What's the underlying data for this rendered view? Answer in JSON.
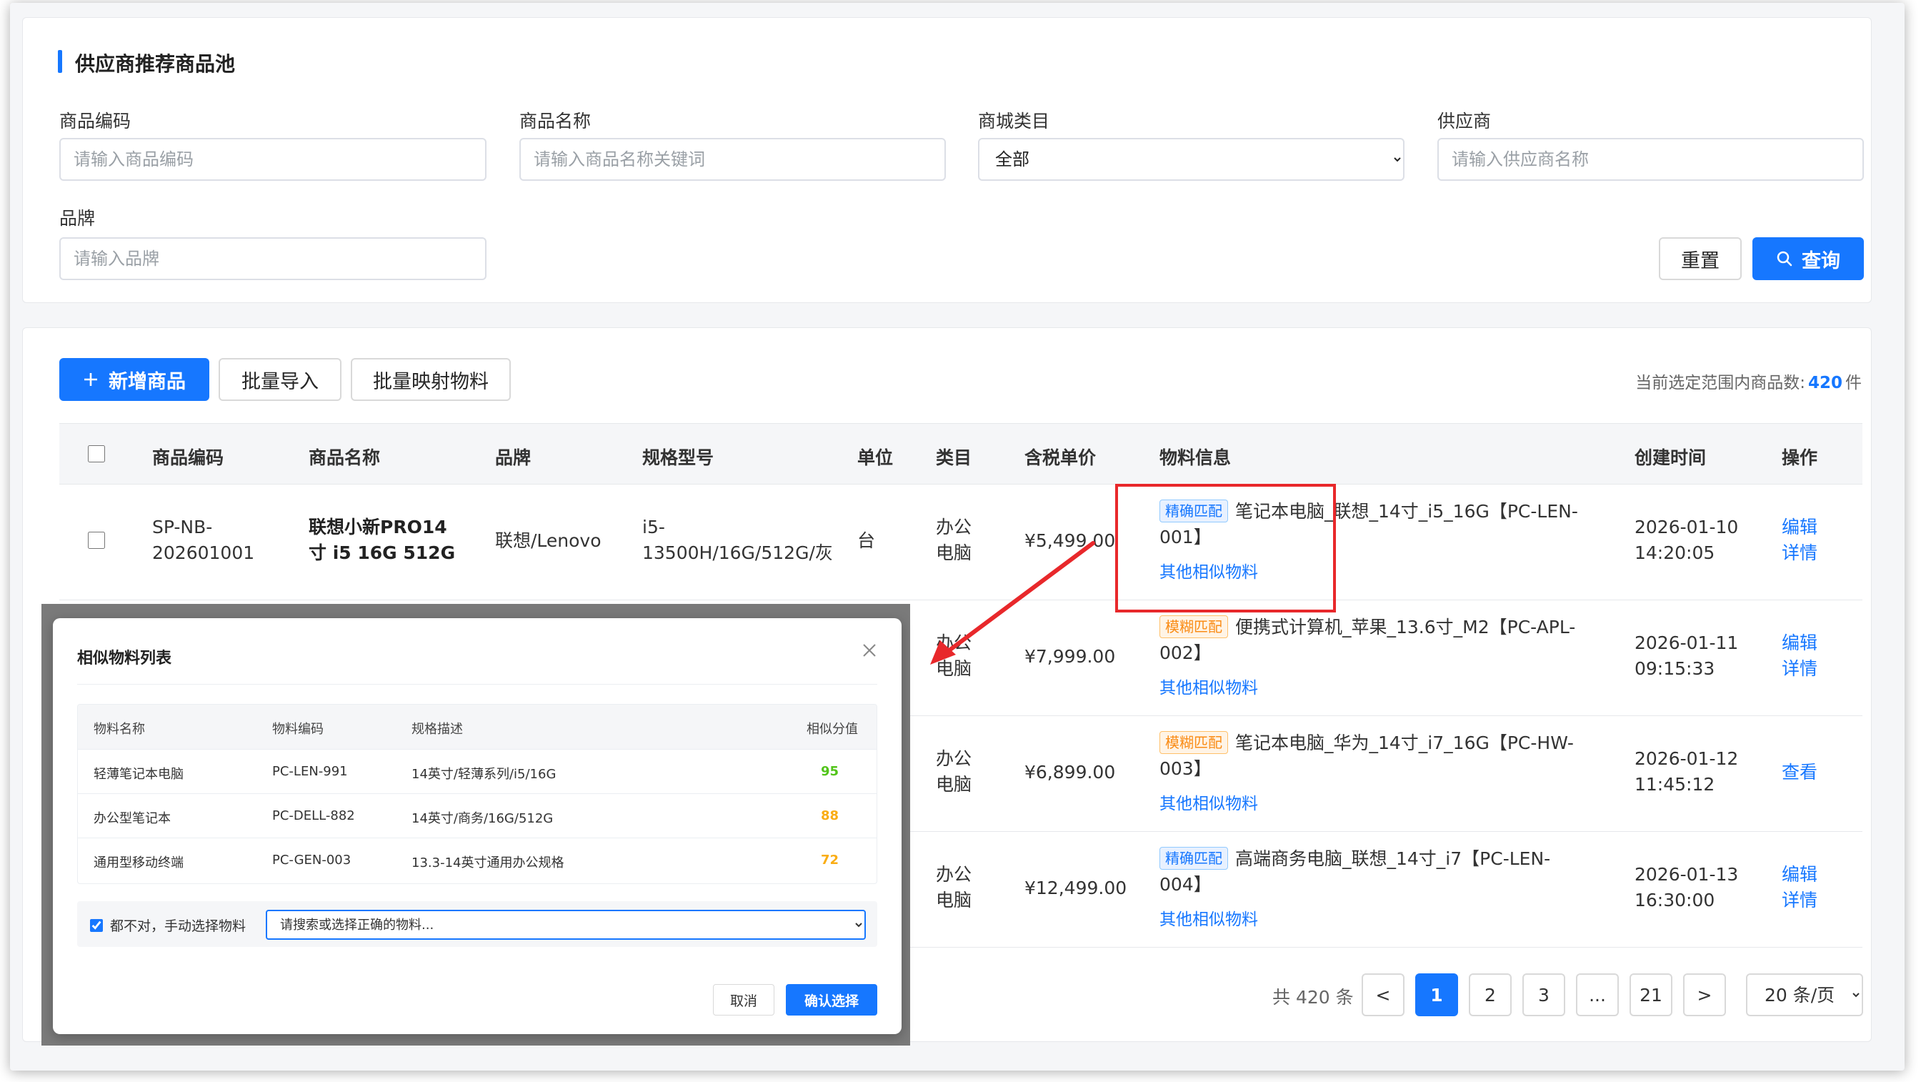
{
  "page": {
    "title": "供应商推荐商品池"
  },
  "filters": {
    "code_label": "商品编码",
    "code_placeholder": "请输入商品编码",
    "name_label": "商品名称",
    "name_placeholder": "请输入商品名称关键词",
    "category_label": "商城类目",
    "category_value": "全部",
    "supplier_label": "供应商",
    "supplier_placeholder": "请输入供应商名称",
    "brand_label": "品牌",
    "brand_placeholder": "请输入品牌",
    "reset_label": "重置",
    "search_label": "查询"
  },
  "toolbar": {
    "add_label": "新增商品",
    "import_label": "批量导入",
    "map_label": "批量映射物料",
    "count_prefix": "当前选定范围内商品数:",
    "count_value": "420",
    "count_unit": "件"
  },
  "table": {
    "headers": {
      "code": "商品编码",
      "name": "商品名称",
      "brand": "品牌",
      "spec": "规格型号",
      "unit": "单位",
      "category": "类目",
      "price": "含税单价",
      "material": "物料信息",
      "created": "创建时间",
      "actions": "操作"
    },
    "rows": [
      {
        "code_a": "SP-NB-",
        "code_b": "202601001",
        "name_a": "联想小新PRO14",
        "name_b": "寸 i5 16G 512G",
        "brand": "联想/Lenovo",
        "spec_a": "i5-",
        "spec_b": "13500H/16G/512G/灰",
        "unit": "台",
        "cat_a": "办公",
        "cat_b": "电脑",
        "price": "¥5,499.00",
        "match_tag": "精确匹配",
        "material_a": "笔记本电脑_联想_14寸_i5_16G【PC-LEN-",
        "material_b": "001】",
        "similar_link": "其他相似物料",
        "date": "2026-01-10",
        "time": "14:20:05",
        "action_1": "编辑",
        "action_2": "详情"
      },
      {
        "cat_a": "办公",
        "cat_b": "电脑",
        "price": "¥7,999.00",
        "match_tag": "模糊匹配",
        "material_a": "便携式计算机_苹果_13.6寸_M2【PC-APL-",
        "material_b": "002】",
        "similar_link": "其他相似物料",
        "date": "2026-01-11",
        "time": "09:15:33",
        "action_1": "编辑",
        "action_2": "详情"
      },
      {
        "cat_a": "办公",
        "cat_b": "电脑",
        "price": "¥6,899.00",
        "match_tag": "模糊匹配",
        "material_a": "笔记本电脑_华为_14寸_i7_16G【PC-HW-",
        "material_b": "003】",
        "similar_link": "其他相似物料",
        "date": "2026-01-12",
        "time": "11:45:12",
        "action_1": "查看"
      },
      {
        "cat_a": "办公",
        "cat_b": "电脑",
        "price": "¥12,499.00",
        "match_tag": "精确匹配",
        "material_a": "高端商务电脑_联想_14寸_i7【PC-LEN-",
        "material_b": "004】",
        "similar_link": "其他相似物料",
        "date": "2026-01-13",
        "time": "16:30:00",
        "action_1": "编辑",
        "action_2": "详情"
      }
    ]
  },
  "pagination": {
    "total": "共 420 条",
    "prev": "<",
    "pages": [
      "1",
      "2",
      "3",
      "...",
      "21"
    ],
    "next": ">",
    "page_size": "20 条/页"
  },
  "modal": {
    "title": "相似物料列表",
    "headers": {
      "name": "物料名称",
      "code": "物料编码",
      "spec": "规格描述",
      "score": "相似分值"
    },
    "rows": [
      {
        "name": "轻薄笔记本电脑",
        "code": "PC-LEN-991",
        "spec": "14英寸/轻薄系列/i5/16G",
        "score": "95"
      },
      {
        "name": "办公型笔记本",
        "code": "PC-DELL-882",
        "spec": "14英寸/商务/16G/512G",
        "score": "88"
      },
      {
        "name": "通用型移动终端",
        "code": "PC-GEN-003",
        "spec": "13.3-14英寸通用办公规格",
        "score": "72"
      }
    ],
    "manual_label": "都不对，手动选择物料",
    "manual_placeholder": "请搜索或选择正确的物料...",
    "cancel_label": "取消",
    "confirm_label": "确认选择"
  },
  "colors": {
    "primary": "#1677ff",
    "annotation_red": "#e8282b",
    "score_high": "#52c41a",
    "score_mid": "#faad14",
    "fuzzy_tag": "#fa8c16"
  },
  "icons": [
    "plus-icon",
    "search-icon",
    "close-icon",
    "chevron-down-icon",
    "arrow-annotation"
  ]
}
